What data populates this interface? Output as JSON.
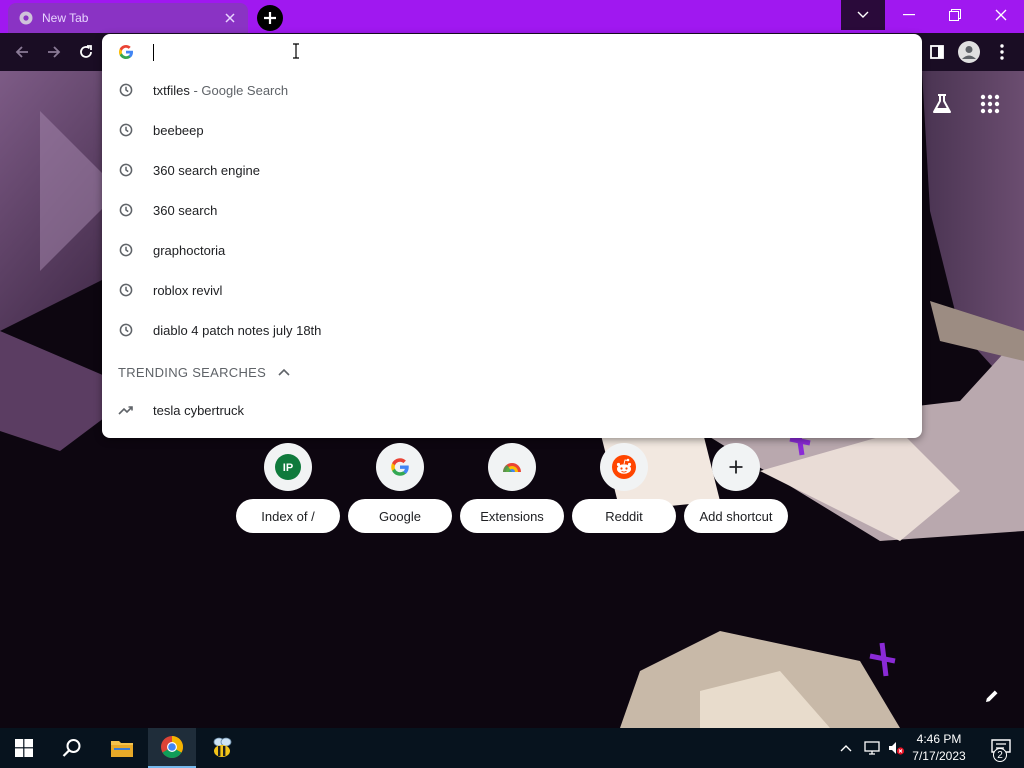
{
  "browser": {
    "tab": {
      "title": "New Tab"
    },
    "accent_color": "#a018f0"
  },
  "omnibox": {
    "value": "",
    "suggestions": [
      {
        "text": "txtfiles",
        "description": " - Google Search",
        "icon": "history-icon"
      },
      {
        "text": "beebeep",
        "description": "",
        "icon": "history-icon"
      },
      {
        "text": "360 search engine",
        "description": "",
        "icon": "history-icon"
      },
      {
        "text": "360 search",
        "description": "",
        "icon": "history-icon"
      },
      {
        "text": "graphoctoria",
        "description": "",
        "icon": "history-icon"
      },
      {
        "text": "roblox revivl",
        "description": "",
        "icon": "history-icon"
      },
      {
        "text": "diablo 4 patch notes july 18th",
        "description": "",
        "icon": "history-icon"
      }
    ],
    "trending_header": "TRENDING SEARCHES",
    "trending": [
      {
        "text": "tesla cybertruck",
        "icon": "trending-icon"
      }
    ]
  },
  "shortcuts": [
    {
      "label": "Index of /",
      "icon": "ip-icon",
      "badge": "IP"
    },
    {
      "label": "Google",
      "icon": "google-icon"
    },
    {
      "label": "Extensions",
      "icon": "chrome-icon"
    },
    {
      "label": "Reddit",
      "icon": "reddit-icon"
    },
    {
      "label": "Add shortcut",
      "icon": "plus-icon"
    }
  ],
  "taskbar": {
    "time": "4:46 PM",
    "date": "7/17/2023",
    "notification_count": "2"
  }
}
